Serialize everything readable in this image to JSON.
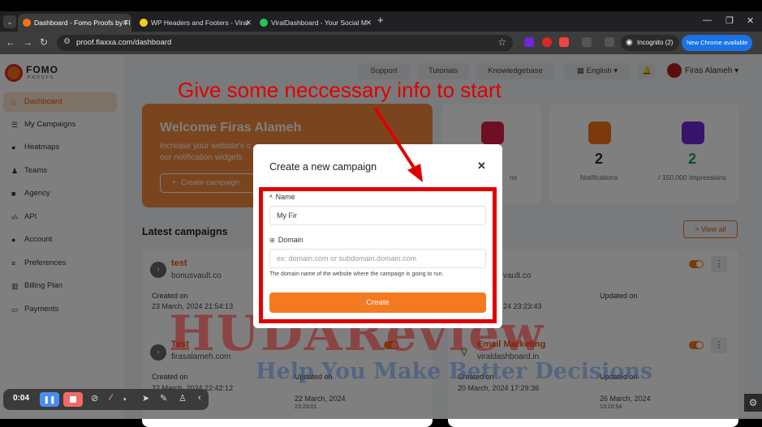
{
  "browser": {
    "tabs": [
      {
        "title": "Dashboard - Fomo Proofs by Fl",
        "active": true,
        "favicon_color": "#f97316"
      },
      {
        "title": "WP Headers and Footers - Viral",
        "active": false,
        "favicon_color": "#facc15"
      },
      {
        "title": "ViralDashboard - Your Social M",
        "active": false,
        "favicon_color": "#22c55e"
      }
    ],
    "url": "proof.flaxxa.com/dashboard",
    "incognito_label": "Incognito (2)",
    "new_chrome_label": "New Chrome available",
    "ext_timer": "0:04"
  },
  "logo": {
    "line1": "FOMO",
    "line2": "PROOFS"
  },
  "sidebar": {
    "items": [
      {
        "label": "Dashboard",
        "icon": "home-icon",
        "active": true
      },
      {
        "label": "My Campaigns",
        "icon": "list-icon"
      },
      {
        "label": "Heatmaps",
        "icon": "fire-icon"
      },
      {
        "label": "Teams",
        "icon": "users-icon"
      },
      {
        "label": "Agency",
        "icon": "briefcase-icon"
      },
      {
        "label": "API",
        "icon": "code-icon"
      },
      {
        "label": "Account",
        "icon": "user-icon"
      },
      {
        "label": "Preferences",
        "icon": "sliders-icon"
      },
      {
        "label": "Billing Plan",
        "icon": "bank-icon"
      },
      {
        "label": "Payments",
        "icon": "card-icon"
      }
    ]
  },
  "topnav": {
    "support": "Support",
    "tutorials": "Tutorials",
    "knowledgebase": "Knowledgebase",
    "language": "English",
    "user_name": "Firas Alameh"
  },
  "welcome": {
    "title": "Welcome Firas Alameh",
    "line1": "Increase your website's c",
    "line2": "our notification widgets",
    "button": "Create campaign"
  },
  "stats": [
    {
      "value": "",
      "label": "ns",
      "color": "#e11d48"
    },
    {
      "value": "2",
      "label": "Notifications",
      "color": "#f97316"
    },
    {
      "value": "2",
      "label": "/ 150,000 Impressions",
      "color": "#6d28d9"
    }
  ],
  "campaigns": {
    "title": "Latest campaigns",
    "view_all": "> View all",
    "created_on_label": "Created on",
    "updated_on_label": "Updated on",
    "items": [
      {
        "name": "test",
        "domain": "bonusvault.co",
        "created": "23 March, 2024  21:54:13"
      },
      {
        "name": "",
        "domain": "vault.co",
        "updated": "",
        "updated_time": "24  23:23:43"
      },
      {
        "name": "Test",
        "domain": "firasalameh.com",
        "created": "22 March, 2024  22:42:12",
        "updated": "22 March, 2024",
        "updated_time": "23:23:01"
      },
      {
        "name": "Email Marketing",
        "domain": "viraldashboard.in",
        "created": "20 March, 2024  17:29:36",
        "updated": "26 March, 2024",
        "updated_time": "13:10:54"
      }
    ]
  },
  "modal": {
    "title": "Create a new campaign",
    "name_label": "Name",
    "name_value": "My Fir",
    "domain_label": "Domain",
    "domain_placeholder": "ex: domain.com or subdomain.domain.com",
    "domain_hint": "The domain name of the website where the campaign is going to run.",
    "create_button": "Create"
  },
  "annotation": "Give some neccessary info to start",
  "watermark": {
    "brand": "HUDAReview",
    "tagline": "Help You Make Better Decisions"
  },
  "recorder": {
    "time": "0:04"
  }
}
